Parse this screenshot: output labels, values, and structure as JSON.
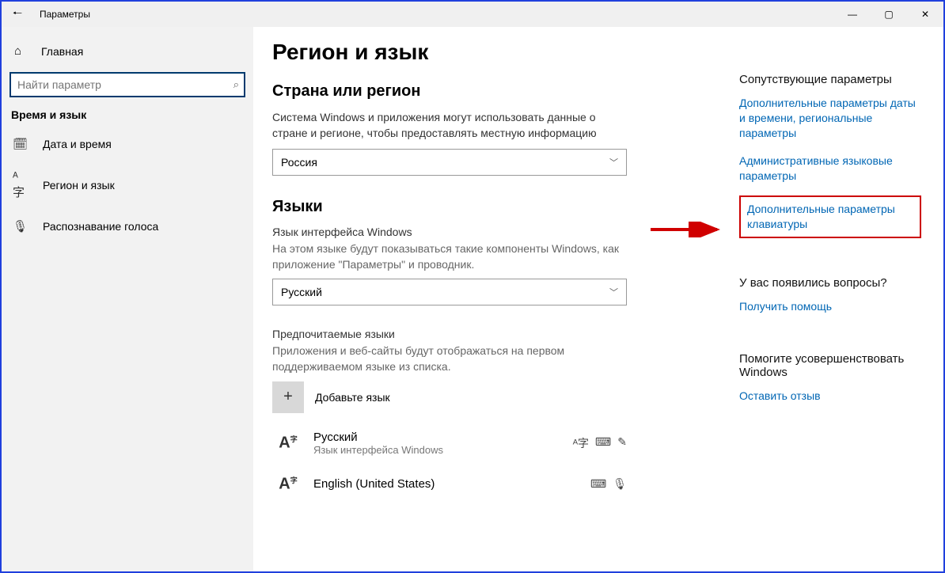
{
  "window": {
    "title": "Параметры"
  },
  "sidebar": {
    "home": "Главная",
    "search_placeholder": "Найти параметр",
    "section": "Время и язык",
    "items": [
      {
        "label": "Дата и время",
        "icon": "🗓"
      },
      {
        "label": "Регион и язык",
        "icon": "ᴬ字"
      },
      {
        "label": "Распознавание голоса",
        "icon": "🎤"
      }
    ]
  },
  "main": {
    "title": "Регион и язык",
    "region": {
      "heading": "Страна или регион",
      "desc": "Система Windows и приложения могут использовать данные о стране и регионе, чтобы предоставлять местную информацию",
      "value": "Россия"
    },
    "languages": {
      "heading": "Языки",
      "display_label": "Язык интерфейса Windows",
      "display_desc": "На этом языке будут показываться такие компоненты Windows, как приложение \"Параметры\" и проводник.",
      "display_value": "Русский",
      "pref_label": "Предпочитаемые языки",
      "pref_desc": "Приложения и веб-сайты будут отображаться на первом поддерживаемом языке из списка.",
      "add_label": "Добавьте язык",
      "list": [
        {
          "name": "Русский",
          "sub": "Язык интерфейса Windows",
          "icons": [
            "ᴬ字",
            "⌨",
            "✎"
          ]
        },
        {
          "name": "English (United States)",
          "sub": "",
          "icons": [
            "⌨",
            "🎤"
          ]
        }
      ]
    }
  },
  "right": {
    "related_head": "Сопутствующие параметры",
    "links": [
      "Дополнительные параметры даты и времени, региональные параметры",
      "Административные языковые параметры",
      "Дополнительные параметры клавиатуры"
    ],
    "q_head": "У вас появились вопросы?",
    "help": "Получить помощь",
    "improve_head": "Помогите усовершенствовать Windows",
    "feedback": "Оставить отзыв"
  }
}
